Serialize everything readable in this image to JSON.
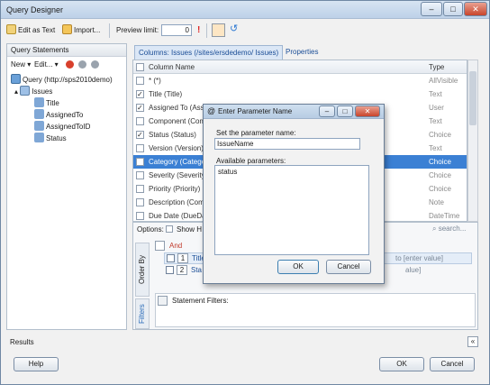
{
  "window": {
    "title": "Query Designer",
    "minimize": "–",
    "maximize": "□",
    "close": "✕"
  },
  "toolbar": {
    "edit_as_text": "Edit as Text",
    "import": "Import...",
    "preview_limit_label": "Preview limit:",
    "preview_limit_value": "0",
    "bang": "!"
  },
  "left": {
    "header": "Query Statements",
    "new": "New",
    "edit": "Edit...",
    "tree": {
      "root": "Query (http://sps2010demo)",
      "list": "Issues",
      "fields": [
        "Title",
        "AssignedTo",
        "AssignedToID",
        "Status"
      ]
    }
  },
  "tabs": [
    {
      "label": "Columns: Issues (/sites/ersdedemo/ Issues)"
    },
    {
      "label": "Properties"
    }
  ],
  "grid": {
    "headers": {
      "name": "Column Name",
      "type": "Type"
    },
    "rows": [
      {
        "name": "* (*)",
        "type": "AllVisible",
        "checked": false
      },
      {
        "name": "Title (Title)",
        "type": "Text",
        "checked": true
      },
      {
        "name": "Assigned To (Assi",
        "type": "User",
        "checked": true
      },
      {
        "name": "Component (Comp",
        "type": "Text",
        "checked": false
      },
      {
        "name": "Status (Status)",
        "type": "Choice",
        "checked": true
      },
      {
        "name": "Version (Version)",
        "type": "Text",
        "checked": false
      },
      {
        "name": "Category (Categor",
        "type": "Choice",
        "checked": false,
        "selected": true
      },
      {
        "name": "Severity (Severity)",
        "type": "Choice",
        "checked": false
      },
      {
        "name": "Priority (Priority)",
        "type": "Choice",
        "checked": false
      },
      {
        "name": "Description (Comm",
        "type": "Note",
        "checked": false
      },
      {
        "name": "Due Date (DueDa",
        "type": "DateTime",
        "checked": false
      }
    ]
  },
  "options": {
    "label": "Options:",
    "show": "Show H",
    "search": "search..."
  },
  "filters": {
    "and_label": "And",
    "rows": [
      {
        "num": "1",
        "field": "Title",
        "value": "to [enter value]"
      },
      {
        "num": "2",
        "field": "Sta",
        "value": "alue]"
      }
    ],
    "order_by_tab": "Order By",
    "filters_tab": "Filters",
    "statement_filters": "Statement Filters:"
  },
  "dialog": {
    "title": "Enter Parameter Name",
    "set_name_label": "Set the parameter name:",
    "name_value": "IssueName",
    "available_label": "Available parameters:",
    "params": [
      "status"
    ],
    "ok": "OK",
    "cancel": "Cancel"
  },
  "footer": {
    "results": "Results",
    "help": "Help",
    "ok": "OK",
    "cancel": "Cancel"
  },
  "colors": {
    "accent": "#3b80d4",
    "link": "#1a4d96",
    "and_red": "#c0392b"
  }
}
